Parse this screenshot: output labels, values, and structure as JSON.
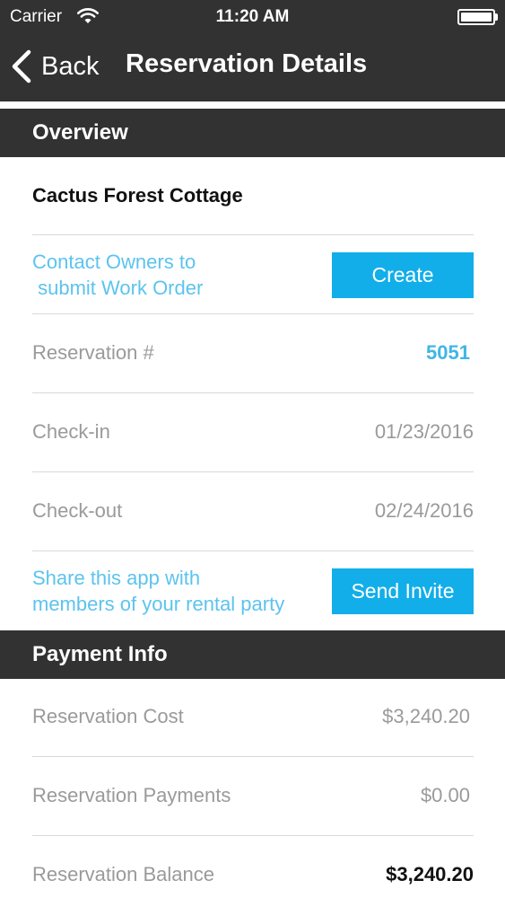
{
  "status_bar": {
    "carrier": "Carrier",
    "time": "11:20 AM"
  },
  "nav": {
    "back_label": "Back",
    "title": "Reservation Details"
  },
  "overview": {
    "header": "Overview",
    "property_name": "Cactus Forest Cottage",
    "contact_text_1": "Contact Owners to",
    "contact_text_2": " submit Work Order",
    "create_button": "Create",
    "reservation_label": "Reservation #",
    "reservation_value": "5051",
    "checkin_label": "Check-in",
    "checkin_value": "01/23/2016",
    "checkout_label": "Check-out",
    "checkout_value": "02/24/2016",
    "share_text_1": "Share this app with",
    "share_text_2": "members of your rental party",
    "invite_button": "Send Invite"
  },
  "payment": {
    "header": "Payment Info",
    "cost_label": "Reservation Cost",
    "cost_value": "$3,240.20",
    "payments_label": "Reservation Payments",
    "payments_value": "$0.00",
    "balance_label": "Reservation Balance",
    "balance_value": "$3,240.20"
  },
  "icons": {
    "back": "chevron-left-icon",
    "wifi": "wifi-icon",
    "battery": "battery-icon"
  },
  "colors": {
    "header_bg": "#323233",
    "accent": "#12aee9",
    "link": "#5cc3ef",
    "muted": "#9a9a9a"
  }
}
